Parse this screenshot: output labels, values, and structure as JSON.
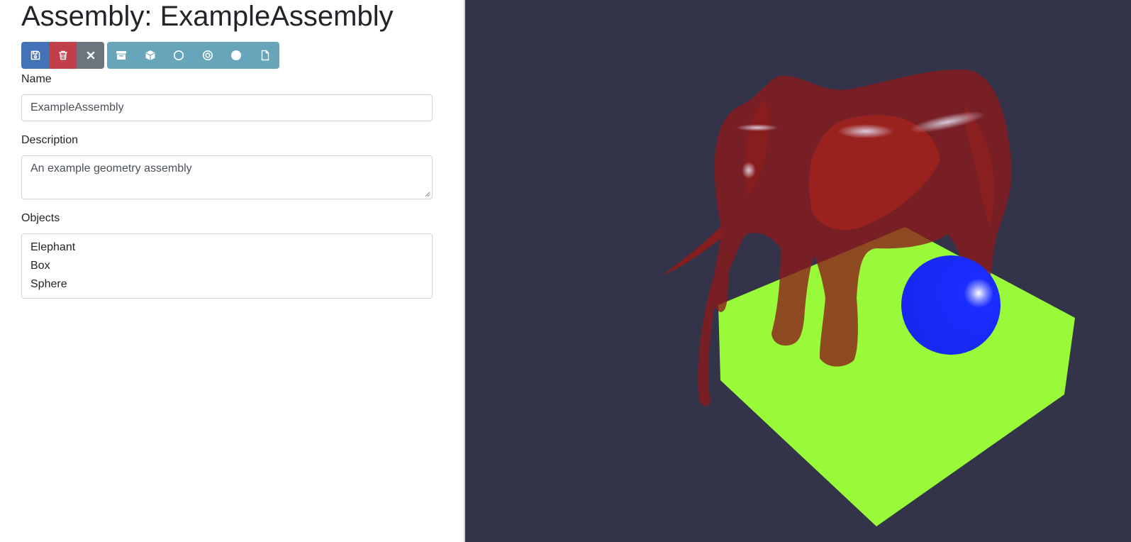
{
  "page": {
    "title": "Assembly: ExampleAssembly"
  },
  "toolbar": {
    "primary_buttons": [
      {
        "icon": "save-icon",
        "color": "#4472b7"
      },
      {
        "icon": "trash-icon",
        "color": "#c13f4b"
      },
      {
        "icon": "close-icon",
        "color": "#6c757d"
      }
    ],
    "add_buttons": [
      {
        "icon": "archive-icon"
      },
      {
        "icon": "cube-icon"
      },
      {
        "icon": "circle-outline-icon"
      },
      {
        "icon": "bullseye-icon"
      },
      {
        "icon": "filled-circle-icon"
      },
      {
        "icon": "file-icon"
      }
    ],
    "add_color": "#66a5ba"
  },
  "form": {
    "name_label": "Name",
    "name_value": "ExampleAssembly",
    "description_label": "Description",
    "description_value": "An example geometry assembly",
    "objects_label": "Objects",
    "objects": [
      "Elephant",
      "Box",
      "Sphere"
    ]
  },
  "viewport": {
    "background": "#33334a",
    "objects": [
      {
        "name": "Elephant",
        "color": "#8b1a1a"
      },
      {
        "name": "Box",
        "color": "#99fa3a"
      },
      {
        "name": "Sphere",
        "color": "#1a2cff"
      }
    ]
  }
}
